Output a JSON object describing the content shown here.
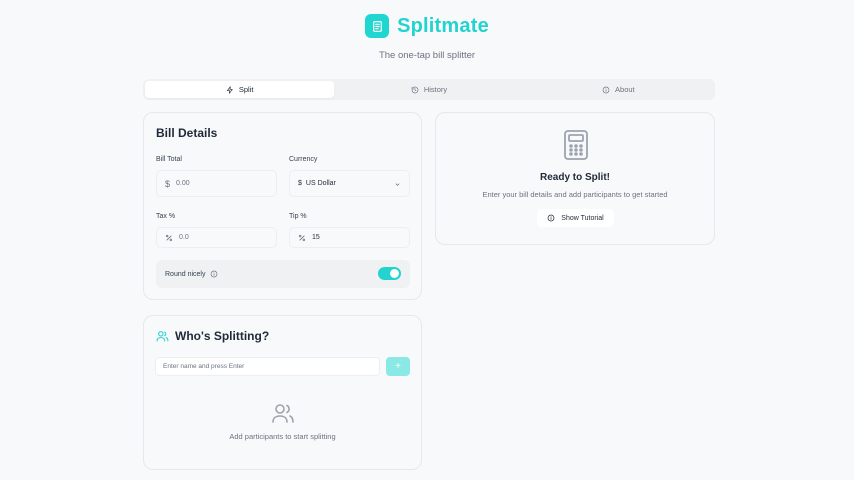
{
  "header": {
    "app_title": "Splitmate",
    "subtitle": "The one-tap bill splitter",
    "logo_icon": "receipt-icon",
    "accent_color": "#22d3cf"
  },
  "tabs": [
    {
      "label": "Split",
      "icon": "zap-icon",
      "active": true
    },
    {
      "label": "History",
      "icon": "history-icon",
      "active": false
    },
    {
      "label": "About",
      "icon": "info-icon",
      "active": false
    }
  ],
  "bill": {
    "title": "Bill Details",
    "total_label": "Bill Total",
    "total_placeholder": "0.00",
    "currency_label": "Currency",
    "currency_value": "US Dollar",
    "currency_symbol": "$",
    "tax_label": "Tax %",
    "tax_placeholder": "0.0",
    "tip_label": "Tip %",
    "tip_value": "15",
    "round_label": "Round nicely",
    "round_enabled": true
  },
  "ready": {
    "title": "Ready to Split!",
    "subtitle": "Enter your bill details and add participants to get started",
    "button_label": "Show Tutorial",
    "icon": "calculator-icon"
  },
  "participants": {
    "title": "Who's Splitting?",
    "input_placeholder": "Enter name and press Enter",
    "add_label": "+",
    "empty_text": "Add participants to start splitting",
    "icon": "users-icon"
  }
}
